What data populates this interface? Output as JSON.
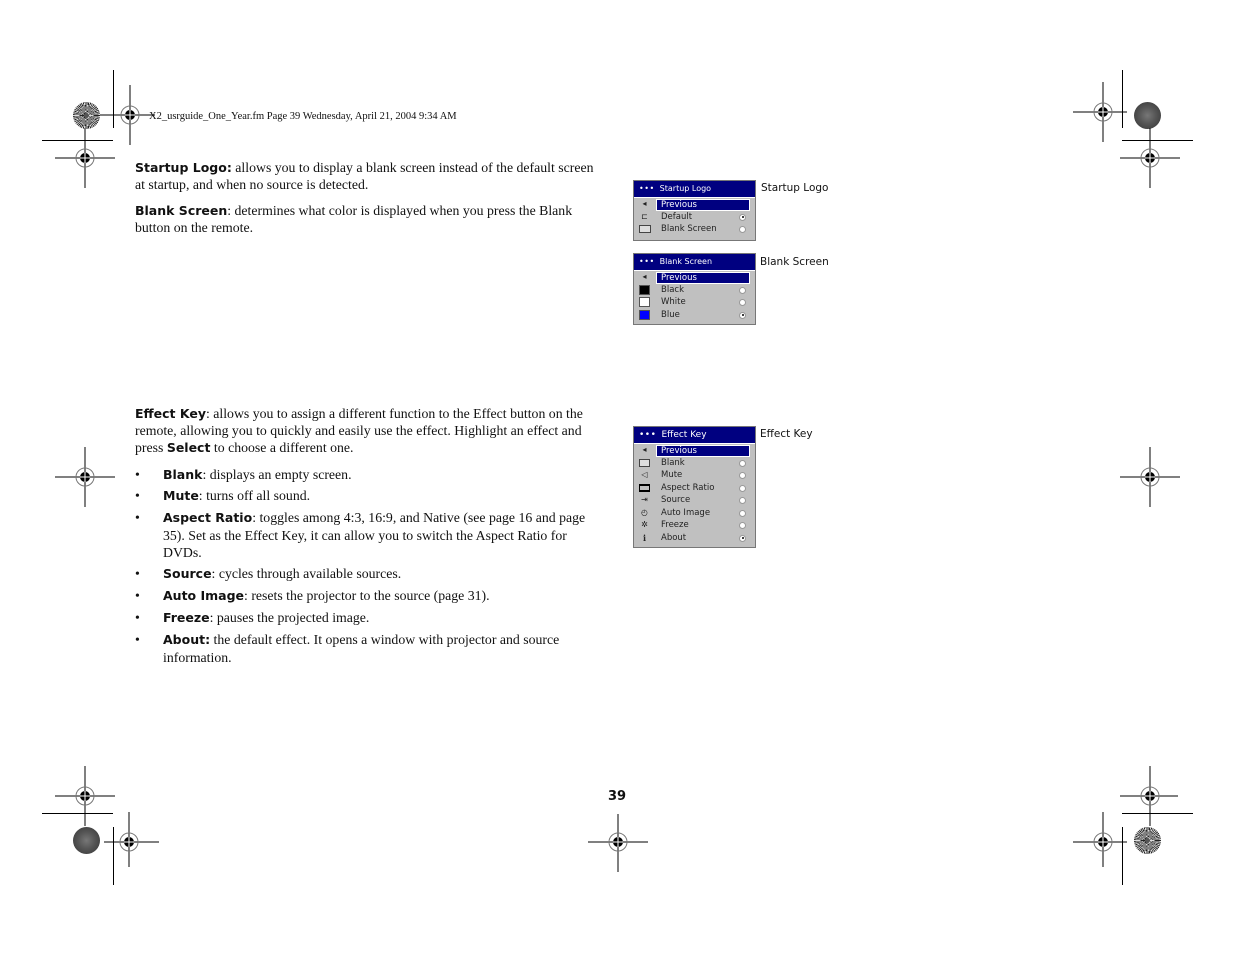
{
  "header": {
    "file_line": "X2_usrguide_One_Year.fm  Page 39  Wednesday, April 21, 2004  9:34 AM"
  },
  "sections": {
    "startup_logo": {
      "term": "Startup Logo:",
      "text": " allows you to display a blank screen instead of the default screen at startup, and when no source is detected."
    },
    "blank_screen": {
      "term": "Blank Screen",
      "text": ": determines what color is displayed when you press the Blank button on the remote."
    },
    "effect_key": {
      "term": "Effect Key",
      "text1": ": allows you to assign a different function to the Effect button on the remote, allowing you to quickly and easily use the effect. Highlight an effect and press ",
      "select": "Select",
      "text2": " to choose a different one."
    }
  },
  "bullets": [
    {
      "term": "Blank",
      "text": ": displays an empty screen."
    },
    {
      "term": "Mute",
      "text": ": turns off all sound."
    },
    {
      "term": "Aspect Ratio",
      "text": ": toggles among 4:3, 16:9, and Native (see page 16 and page 35). Set as the Effect Key, it can allow you to switch the Aspect Ratio for DVDs."
    },
    {
      "term": "Source",
      "text": ": cycles through available sources."
    },
    {
      "term": "Auto Image",
      "text": ": resets the projector to the source (page 31)."
    },
    {
      "term": "Freeze",
      "text": ": pauses the projected image."
    },
    {
      "term": "About:",
      "text": " the default effect. It opens a window with projector and source information."
    }
  ],
  "bullet_char": "•",
  "menus": {
    "startup_logo": {
      "title": "Startup Logo",
      "caption": "Startup Logo",
      "previous": "Previous",
      "items": [
        {
          "label": "Default",
          "icon": "logo-icon",
          "selected": true
        },
        {
          "label": "Blank Screen",
          "icon": "blank-screen-icon",
          "selected": false
        }
      ]
    },
    "blank_screen": {
      "title": "Blank Screen",
      "caption": "Blank Screen",
      "previous": "Previous",
      "items": [
        {
          "label": "Black",
          "color": "#000000",
          "selected": false
        },
        {
          "label": "White",
          "color": "#ffffff",
          "selected": false
        },
        {
          "label": "Blue",
          "color": "#0000ff",
          "selected": true
        }
      ]
    },
    "effect_key": {
      "title": "Effect Key",
      "caption": "Effect Key",
      "previous": "Previous",
      "items": [
        {
          "label": "Blank",
          "icon": "blank-icon",
          "selected": false
        },
        {
          "label": "Mute",
          "icon": "mute-icon",
          "selected": false
        },
        {
          "label": "Aspect Ratio",
          "icon": "aspect-ratio-icon",
          "selected": false
        },
        {
          "label": "Source",
          "icon": "source-icon",
          "selected": false
        },
        {
          "label": "Auto Image",
          "icon": "auto-image-icon",
          "selected": false
        },
        {
          "label": "Freeze",
          "icon": "freeze-icon",
          "selected": false
        },
        {
          "label": "About",
          "icon": "about-icon",
          "selected": true
        }
      ]
    }
  },
  "menu_glyphs": {
    "dots": "•••",
    "back_arrow": "◂",
    "mute": "◁",
    "source": "⇥",
    "auto_image": "◴",
    "freeze": "✲",
    "about": "i",
    "logo": "⊏"
  },
  "colors": {
    "menu_title_bg": "#000080",
    "menu_bg": "#c0c0c0"
  },
  "page_number": "39"
}
